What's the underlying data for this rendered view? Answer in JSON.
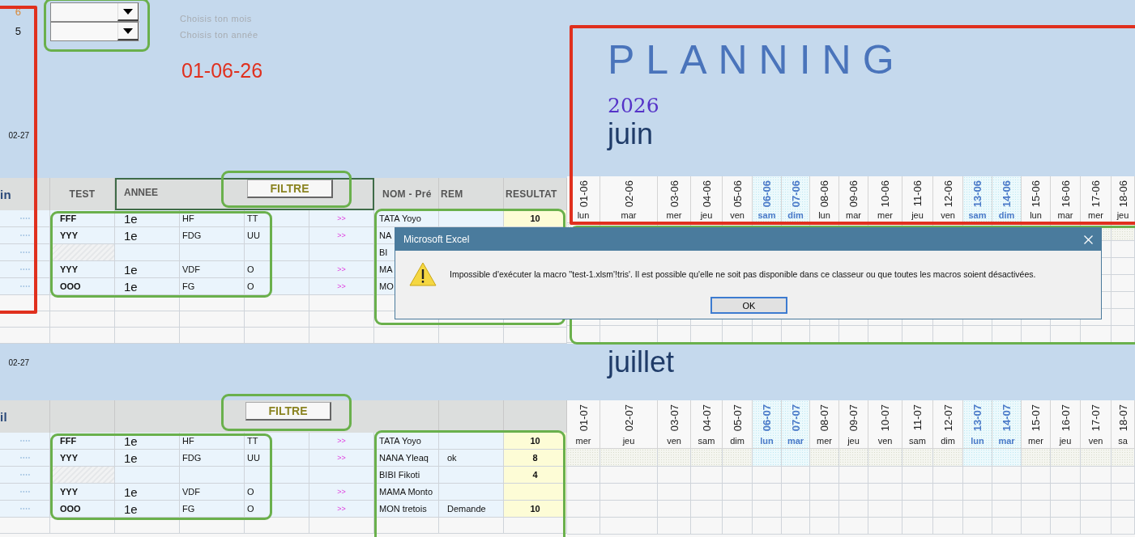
{
  "sections": [
    {
      "side_values": [
        "6",
        "5"
      ],
      "dropdowns": [
        {
          "label": "Choisis ton mois"
        },
        {
          "label": "Choisis ton année"
        }
      ],
      "date": "01-06-26",
      "title": "PLANNING",
      "year": "2026",
      "side_date": "02-27",
      "month": "juin",
      "row_label": "in",
      "columns": {
        "test": "TEST",
        "annee": "ANNEE",
        "nom": "NOM - Pré",
        "rem": "REM",
        "resultat": "RESULTAT"
      },
      "filter_button": "FILTRE",
      "rows": [
        {
          "test": "FFF",
          "annee": "1e",
          "code": "HF",
          "type": "TT",
          "link": ">>",
          "name": "TATA Yoyo",
          "result": "10",
          "hatched": false
        },
        {
          "test": "YYY",
          "annee": "1e",
          "code": "FDG",
          "type": "UU",
          "link": ">>",
          "name": "NA",
          "hatched": false
        },
        {
          "name": "BI",
          "hatched": true
        },
        {
          "test": "YYY",
          "annee": "1e",
          "code": "VDF",
          "type": "O",
          "link": ">>",
          "name": "MA",
          "hatched": false
        },
        {
          "test": "OOO",
          "annee": "1e",
          "code": "FG",
          "type": "O",
          "link": ">>",
          "name": "MO",
          "hatched": false
        }
      ],
      "days": [
        {
          "date": "01-06",
          "day": "lun",
          "highlighted": false
        },
        {
          "date": "02-06",
          "day": "mar",
          "highlighted": false
        },
        {
          "date": "03-06",
          "day": "mer",
          "highlighted": false
        },
        {
          "date": "04-06",
          "day": "jeu",
          "highlighted": false
        },
        {
          "date": "05-06",
          "day": "ven",
          "highlighted": false
        },
        {
          "date": "06-06",
          "day": "sam",
          "highlighted": true
        },
        {
          "date": "07-06",
          "day": "dim",
          "highlighted": true
        },
        {
          "date": "08-06",
          "day": "lun",
          "highlighted": false
        },
        {
          "date": "09-06",
          "day": "mar",
          "highlighted": false
        },
        {
          "date": "10-06",
          "day": "mer",
          "highlighted": false
        },
        {
          "date": "11-06",
          "day": "jeu",
          "highlighted": false
        },
        {
          "date": "12-06",
          "day": "ven",
          "highlighted": false
        },
        {
          "date": "13-06",
          "day": "sam",
          "highlighted": true
        },
        {
          "date": "14-06",
          "day": "dim",
          "highlighted": true
        },
        {
          "date": "15-06",
          "day": "lun",
          "highlighted": false
        },
        {
          "date": "16-06",
          "day": "mar",
          "highlighted": false
        },
        {
          "date": "17-06",
          "day": "mer",
          "highlighted": false
        },
        {
          "date": "18-06",
          "day": "jeu",
          "highlighted": false
        }
      ]
    },
    {
      "side_date": "02-27",
      "month": "juillet",
      "row_label": "il",
      "filter_button": "FILTRE",
      "rows": [
        {
          "test": "FFF",
          "annee": "1e",
          "code": "HF",
          "type": "TT",
          "link": ">>",
          "name": "TATA Yoyo",
          "result": "10",
          "hatched": false
        },
        {
          "test": "YYY",
          "annee": "1e",
          "code": "FDG",
          "type": "UU",
          "link": ">>",
          "name": "NANA Yleaq",
          "rem": "ok",
          "result": "8",
          "hatched": false
        },
        {
          "name": "BIBI Fikoti",
          "result": "4",
          "hatched": true
        },
        {
          "test": "YYY",
          "annee": "1e",
          "code": "VDF",
          "type": "O",
          "link": ">>",
          "name": "MAMA Monto",
          "hatched": false
        },
        {
          "test": "OOO",
          "annee": "1e",
          "code": "FG",
          "type": "O",
          "link": ">>",
          "name": "MON tretois",
          "rem": "Demande",
          "result": "10",
          "hatched": false
        }
      ],
      "days": [
        {
          "date": "01-07",
          "day": "mer",
          "highlighted": false
        },
        {
          "date": "02-07",
          "day": "jeu",
          "highlighted": false
        },
        {
          "date": "03-07",
          "day": "ven",
          "highlighted": false
        },
        {
          "date": "04-07",
          "day": "sam",
          "highlighted": false
        },
        {
          "date": "05-07",
          "day": "dim",
          "highlighted": false
        },
        {
          "date": "06-07",
          "day": "lun",
          "highlighted": true
        },
        {
          "date": "07-07",
          "day": "mar",
          "highlighted": true
        },
        {
          "date": "08-07",
          "day": "mer",
          "highlighted": false
        },
        {
          "date": "09-07",
          "day": "jeu",
          "highlighted": false
        },
        {
          "date": "10-07",
          "day": "ven",
          "highlighted": false
        },
        {
          "date": "11-07",
          "day": "sam",
          "highlighted": false
        },
        {
          "date": "12-07",
          "day": "dim",
          "highlighted": false
        },
        {
          "date": "13-07",
          "day": "lun",
          "highlighted": true
        },
        {
          "date": "14-07",
          "day": "mar",
          "highlighted": true
        },
        {
          "date": "15-07",
          "day": "mer",
          "highlighted": false
        },
        {
          "date": "16-07",
          "day": "jeu",
          "highlighted": false
        },
        {
          "date": "17-07",
          "day": "ven",
          "highlighted": false
        },
        {
          "date": "18-07",
          "day": "sa",
          "highlighted": false
        }
      ]
    }
  ],
  "dialog": {
    "title": "Microsoft Excel",
    "message": "Impossible d'exécuter la macro ''test-1.xlsm'!tris'. Il est possible qu'elle ne soit pas disponible dans ce classeur ou que toutes les macros soient désactivées.",
    "button": "OK"
  }
}
